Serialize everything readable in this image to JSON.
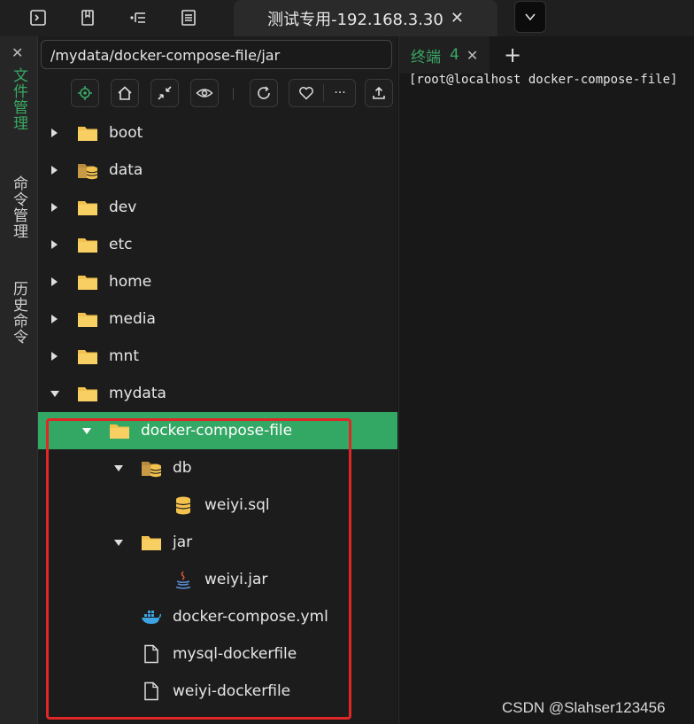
{
  "window": {
    "tab_title": "测试专用-192.168.3.30",
    "tab_close": "✕"
  },
  "sidebar": {
    "close": "✕",
    "tabs": [
      {
        "label": "文件管理",
        "active": true
      },
      {
        "label": "命令管理",
        "active": false
      },
      {
        "label": "历史命令",
        "active": false
      }
    ]
  },
  "filepanel": {
    "path": "/mydata/docker-compose-file/jar",
    "toolbar": [
      "locate-icon",
      "home-icon",
      "collapse-icon",
      "eye-icon",
      "refresh-icon",
      "heart-icon",
      "more-icon",
      "upload-icon"
    ],
    "more_label": "···"
  },
  "tree": [
    {
      "name": "boot",
      "type": "folder",
      "expanded": false
    },
    {
      "name": "data",
      "type": "db-folder",
      "expanded": false
    },
    {
      "name": "dev",
      "type": "folder",
      "expanded": false
    },
    {
      "name": "etc",
      "type": "folder",
      "expanded": false
    },
    {
      "name": "home",
      "type": "folder",
      "expanded": false
    },
    {
      "name": "media",
      "type": "folder",
      "expanded": false
    },
    {
      "name": "mnt",
      "type": "folder",
      "expanded": false
    },
    {
      "name": "mydata",
      "type": "folder",
      "expanded": true
    },
    {
      "name": "docker-compose-file",
      "type": "folder",
      "expanded": true,
      "selected": true
    },
    {
      "name": "db",
      "type": "db-folder",
      "expanded": true
    },
    {
      "name": "weiyi.sql",
      "type": "sql-file"
    },
    {
      "name": "jar",
      "type": "folder",
      "expanded": true
    },
    {
      "name": "weiyi.jar",
      "type": "java-file"
    },
    {
      "name": "docker-compose.yml",
      "type": "docker-file"
    },
    {
      "name": "mysql-dockerfile",
      "type": "file"
    },
    {
      "name": "weiyi-dockerfile",
      "type": "file"
    }
  ],
  "terminal": {
    "tab_label": "终端",
    "tab_count": "4",
    "tab_close": "✕",
    "add": "+",
    "line": "[root@localhost docker-compose-file]"
  },
  "watermark": "CSDN @Slahser123456",
  "colors": {
    "accent": "#3aa864",
    "selected_row": "#33a865",
    "folder": "#f2c14e",
    "highlight_box": "#e02626"
  }
}
